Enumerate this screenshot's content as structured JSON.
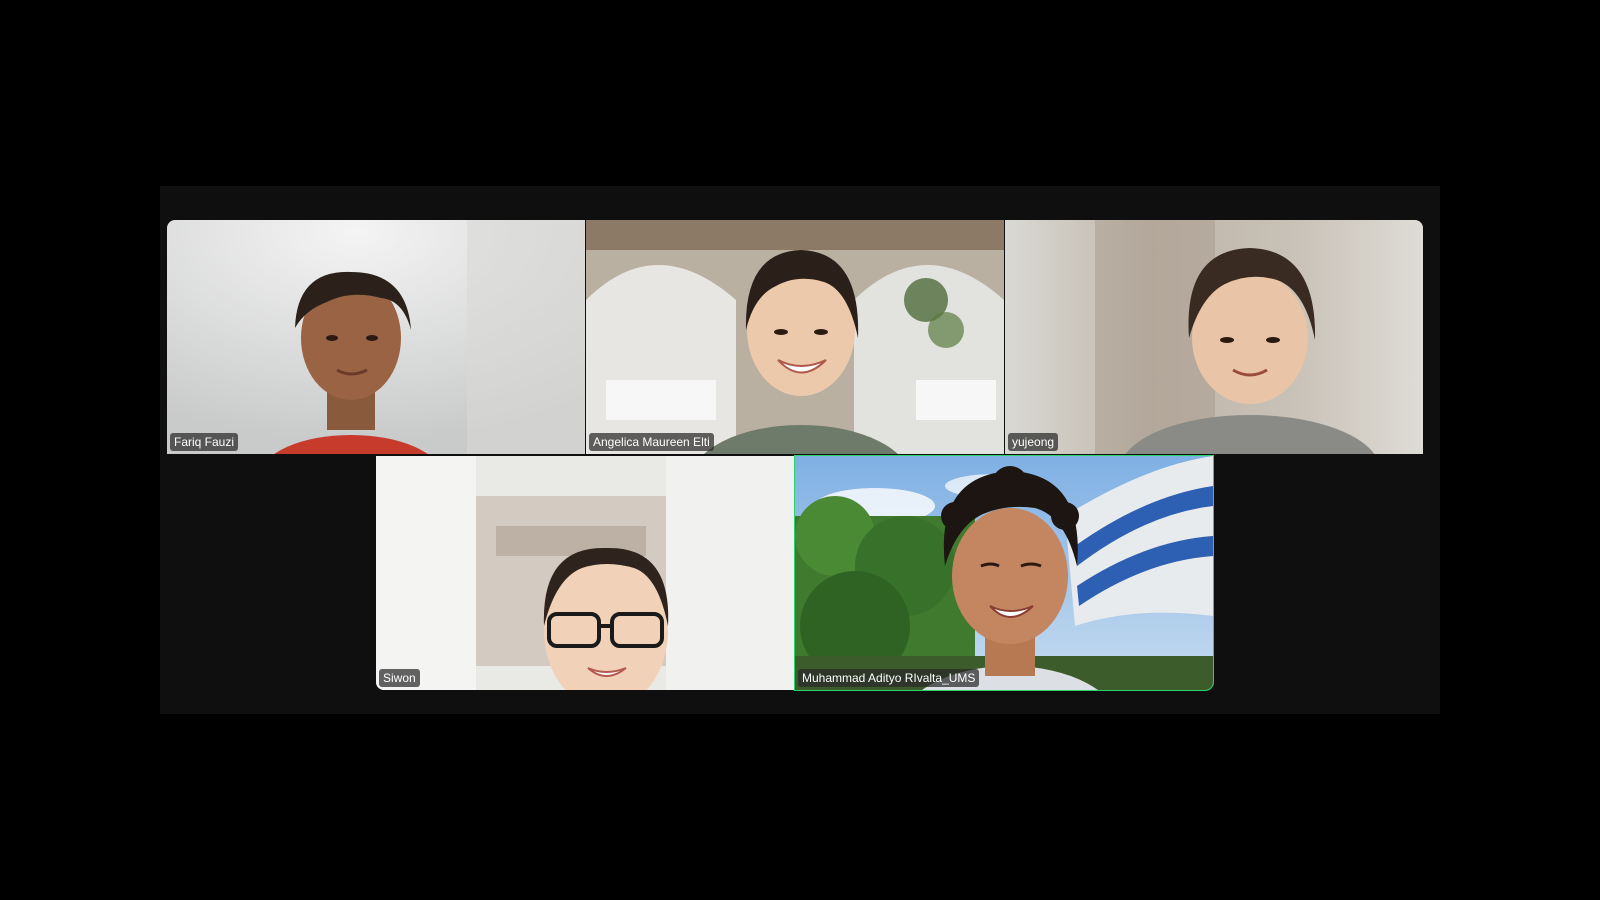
{
  "meeting": {
    "participants": [
      {
        "name": "Fariq Fauzi",
        "speaking": false
      },
      {
        "name": "Angelica Maureen Elti",
        "speaking": false
      },
      {
        "name": "yujeong",
        "speaking": false
      },
      {
        "name": "Siwon",
        "speaking": false
      },
      {
        "name": "Muhammad Adityo RIvalta_UMS",
        "speaking": true
      }
    ],
    "colors": {
      "speaker_outline": "#2bd46b",
      "stage_background": "#0f0f0f",
      "page_background": "#000000"
    }
  }
}
